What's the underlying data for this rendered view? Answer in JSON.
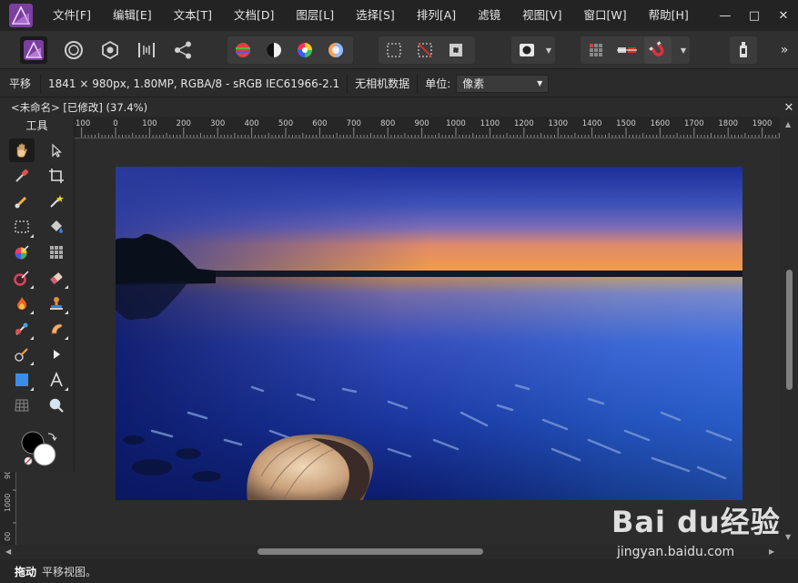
{
  "menubar": {
    "items": [
      "文件[F]",
      "编辑[E]",
      "文本[T]",
      "文档[D]",
      "图层[L]",
      "选择[S]",
      "排列[A]",
      "滤镜",
      "视图[V]",
      "窗口[W]",
      "帮助[H]"
    ],
    "minimize": "—",
    "maximize": "□",
    "close": "✕"
  },
  "toolbar": {
    "more": "»"
  },
  "contextbar": {
    "mode": "平移",
    "info": "1841 × 980px, 1.80MP, RGBA/8 - sRGB IEC61966-2.1",
    "no_camera": "无相机数据",
    "unit_label": "单位:",
    "unit_value": "像素"
  },
  "document": {
    "title": "<未命名> [已修改] (37.4%)",
    "close": "✕"
  },
  "ruler": {
    "h_ticks": [
      "-100",
      "0",
      "100",
      "200",
      "300",
      "400",
      "500",
      "600",
      "700",
      "800",
      "900",
      "1000",
      "1100",
      "1200",
      "1300",
      "1400",
      "1500",
      "1600",
      "1700",
      "1800",
      "1900"
    ],
    "v_ticks": [
      "90",
      "1000",
      "00"
    ]
  },
  "tools": {
    "title": "工具"
  },
  "status": {
    "action": "拖动",
    "description": "平移视图。"
  },
  "watermark": {
    "logo": "Bai du经验",
    "url": "jingyan.baidu.com"
  },
  "colors": {
    "accent": "#7b3fa0",
    "menubar": "#232323",
    "panel": "#2b2b2b"
  }
}
